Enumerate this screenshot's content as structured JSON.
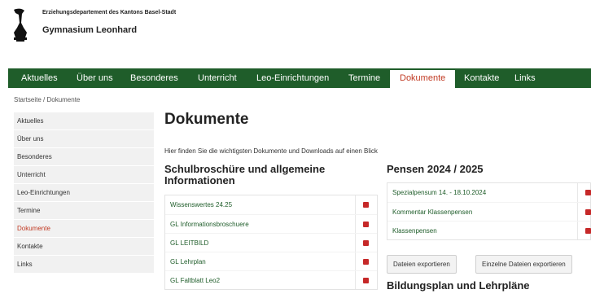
{
  "header": {
    "department": "Erziehungsdepartement des Kantons Basel-Stadt",
    "school": "Gymnasium Leonhard"
  },
  "nav": {
    "items": [
      {
        "label": "Aktuelles"
      },
      {
        "label": "Über uns"
      },
      {
        "label": "Besonderes"
      },
      {
        "label": "Unterricht"
      },
      {
        "label": "Leo-Einrichtungen"
      },
      {
        "label": "Termine"
      },
      {
        "label": "Dokumente",
        "active": true
      },
      {
        "label": "Kontakte"
      },
      {
        "label": "Links"
      }
    ]
  },
  "breadcrumb": "Startseite / Dokumente",
  "sidebar": {
    "items": [
      {
        "label": "Aktuelles"
      },
      {
        "label": "Über uns"
      },
      {
        "label": "Besonderes"
      },
      {
        "label": "Unterricht"
      },
      {
        "label": "Leo-Einrichtungen"
      },
      {
        "label": "Termine"
      },
      {
        "label": "Dokumente",
        "active": true
      },
      {
        "label": "Kontakte"
      },
      {
        "label": "Links"
      }
    ]
  },
  "main": {
    "title": "Dokumente",
    "intro": "Hier finden Sie die wichtigsten Dokumente und Downloads auf einen Blick",
    "left_section": {
      "title": "Schulbroschüre und allgemeine Informationen",
      "docs": [
        {
          "label": "Wissenswertes 24.25"
        },
        {
          "label": "GL Informationsbroschuere"
        },
        {
          "label": "GL LEITBILD"
        },
        {
          "label": "GL Lehrplan"
        },
        {
          "label": "GL Faltblatt Leo2"
        }
      ]
    },
    "right_section": {
      "title": "Pensen 2024 / 2025",
      "docs": [
        {
          "label": "Spezialpensum 14. - 18.10.2024"
        },
        {
          "label": "Kommentar Klassenpensen"
        },
        {
          "label": "Klassenpensen"
        }
      ],
      "buttons": {
        "export_all": "Dateien exportieren",
        "export_single": "Einzelne Dateien exportieren"
      }
    },
    "right_section2": {
      "title": "Bildungsplan und Lehrpläne"
    }
  },
  "colors": {
    "nav_bg": "#1f5d2a",
    "accent": "#c13a23",
    "link": "#1f5d2a",
    "pdf_icon": "#c62828"
  }
}
